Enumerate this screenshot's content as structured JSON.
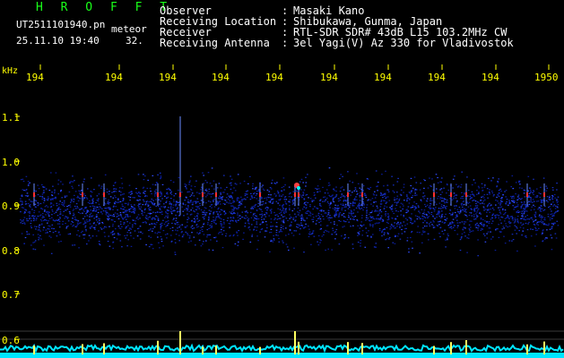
{
  "header": {
    "program": "H R O F F T",
    "file_name": "UT2511101940.pn",
    "event_type": "meteor",
    "date_time": "25.11.10 19:40",
    "count": "32."
  },
  "station": {
    "rows": [
      {
        "label": "Observer",
        "value": "Masaki Kano"
      },
      {
        "label": "Receiving Location",
        "value": "Shibukawa, Gunma, Japan"
      },
      {
        "label": "Receiver",
        "value": "RTL-SDR SDR# 43dB L15 103.2MHz CW"
      },
      {
        "label": "Receiving Antenna",
        "value": "3el Yagi(V) Az 330 for Vladivostok"
      }
    ]
  },
  "axes": {
    "unit": "kHz",
    "time_ticks": [
      "194",
      "194",
      "194",
      "194",
      "194",
      "194",
      "194",
      "194",
      "194",
      "1950"
    ],
    "freq_ticks": [
      "1.1",
      "1.0",
      "0.9",
      "0.8",
      "0.7",
      "0.6"
    ]
  },
  "colors": {
    "title": "#19ff19",
    "axis": "#ffff00",
    "text": "#ffffff",
    "background": "#000000",
    "signal": "#0a1d9c",
    "echo": "#ff3030",
    "level": "#00e5ff"
  }
}
